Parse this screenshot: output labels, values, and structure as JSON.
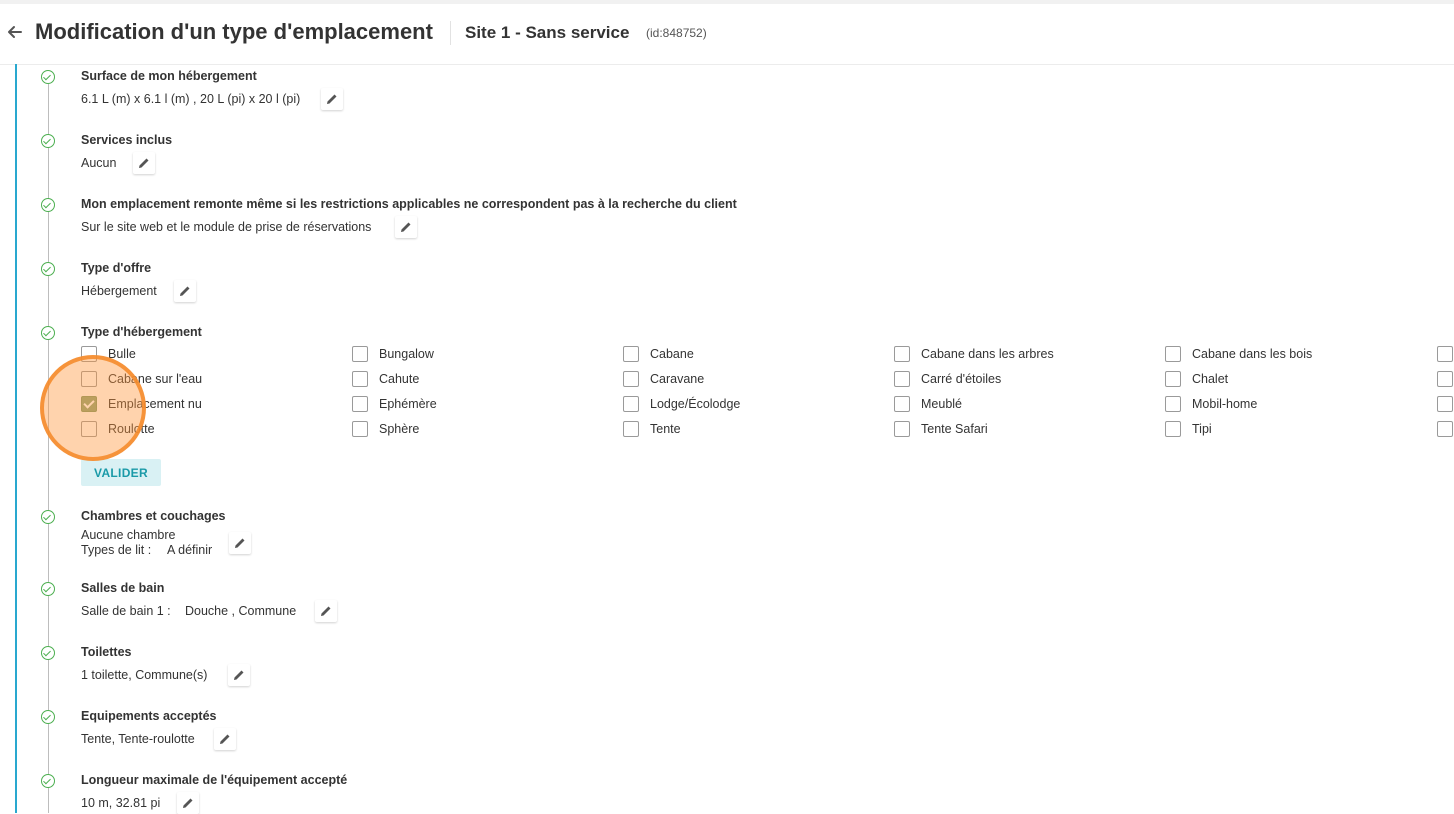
{
  "header": {
    "title": "Modification d'un type d'emplacement",
    "site_name": "Site 1 - Sans service",
    "site_id": "(id:848752)"
  },
  "steps": [
    {
      "title": "Surface de mon hébergement",
      "value": "6.1 L (m) x 6.1 l (m) , 20 L (pi) x 20 l (pi)"
    },
    {
      "title": "Services inclus",
      "value": "Aucun"
    },
    {
      "title": "Mon emplacement remonte même si les restrictions applicables ne correspondent pas à la recherche du client",
      "value": "Sur le site web et le module de prise de réservations"
    },
    {
      "title": "Type d'offre",
      "value": "Hébergement"
    },
    {
      "title": "Type d'hébergement"
    },
    {
      "title": "Chambres et couchages",
      "value": "Aucune chambre",
      "value2_label": "Types de lit :",
      "value2": "A définir"
    },
    {
      "title": "Salles de bain",
      "value_label": "Salle de bain 1 :",
      "value": "Douche , Commune"
    },
    {
      "title": "Toilettes",
      "value": "1 toilette, Commune(s)"
    },
    {
      "title": "Equipements acceptés",
      "value": "Tente, Tente-roulotte"
    },
    {
      "title": "Longueur maximale de l'équipement accepté",
      "value": "10 m, 32.81 pi"
    }
  ],
  "accommodation_types": {
    "options": [
      {
        "label": "Bulle",
        "checked": false
      },
      {
        "label": "Bungalow",
        "checked": false
      },
      {
        "label": "Cabane",
        "checked": false
      },
      {
        "label": "Cabane dans les arbres",
        "checked": false
      },
      {
        "label": "Cabane dans les bois",
        "checked": false
      },
      {
        "label": "Cabane sur l'eau",
        "checked": false
      },
      {
        "label": "Cahute",
        "checked": false
      },
      {
        "label": "Caravane",
        "checked": false
      },
      {
        "label": "Carré d'étoiles",
        "checked": false
      },
      {
        "label": "Chalet",
        "checked": false
      },
      {
        "label": "Emplacement nu",
        "checked": true
      },
      {
        "label": "Ephémère",
        "checked": false
      },
      {
        "label": "Lodge/Écolodge",
        "checked": false
      },
      {
        "label": "Meublé",
        "checked": false
      },
      {
        "label": "Mobil-home",
        "checked": false
      },
      {
        "label": "Roulotte",
        "checked": false
      },
      {
        "label": "Sphère",
        "checked": false
      },
      {
        "label": "Tente",
        "checked": false
      },
      {
        "label": "Tente Safari",
        "checked": false
      },
      {
        "label": "Tipi",
        "checked": false
      }
    ],
    "submit_label": "VALIDER"
  },
  "colors": {
    "accent": "#29a8cf",
    "step_done": "#4caf50",
    "checked": "#8aa678",
    "highlight": "#f58c2d",
    "valider_bg": "#d9f1f4",
    "valider_text": "#1a9aa8"
  }
}
